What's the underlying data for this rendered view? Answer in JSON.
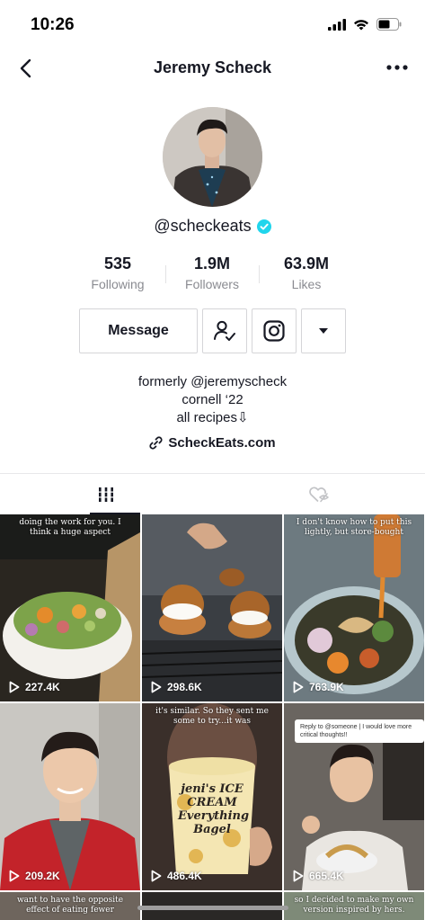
{
  "status_bar": {
    "time": "10:26"
  },
  "nav": {
    "title": "Jeremy Scheck"
  },
  "profile": {
    "handle": "@scheckeats",
    "verified": true,
    "stats": [
      {
        "value": "535",
        "label": "Following"
      },
      {
        "value": "1.9M",
        "label": "Followers"
      },
      {
        "value": "63.9M",
        "label": "Likes"
      }
    ],
    "actions": {
      "message_label": "Message"
    },
    "bio_lines": [
      "formerly @jeremyscheck",
      "cornell ‘22",
      "all recipes⇩"
    ],
    "link": "ScheckEats.com"
  },
  "videos": [
    {
      "caption": "doing the work for you. I think a huge aspect",
      "views": "227.4K"
    },
    {
      "caption": "",
      "views": "298.6K"
    },
    {
      "caption": "I don't know how to put this lightly, but store-bought",
      "views": "763.9K"
    },
    {
      "caption": "",
      "views": "209.2K"
    },
    {
      "caption": "it's similar. So they sent me some to try...it was",
      "product_text": "jeni's ICE CREAM Everything Bagel",
      "views": "486.4K"
    },
    {
      "caption": "",
      "speech_bubble": "Reply to @someone | I would love more critical thoughts!!",
      "views": "665.4K"
    },
    {
      "caption": "want to have the opposite effect of eating fewer",
      "views": ""
    },
    {
      "caption": "",
      "views": ""
    },
    {
      "caption": "so I decided to make my own version inspired by hers.",
      "views": ""
    }
  ],
  "colors": {
    "verified_blue": "#20d5ec",
    "text": "#161823",
    "secondary_text": "#8a8b91"
  }
}
